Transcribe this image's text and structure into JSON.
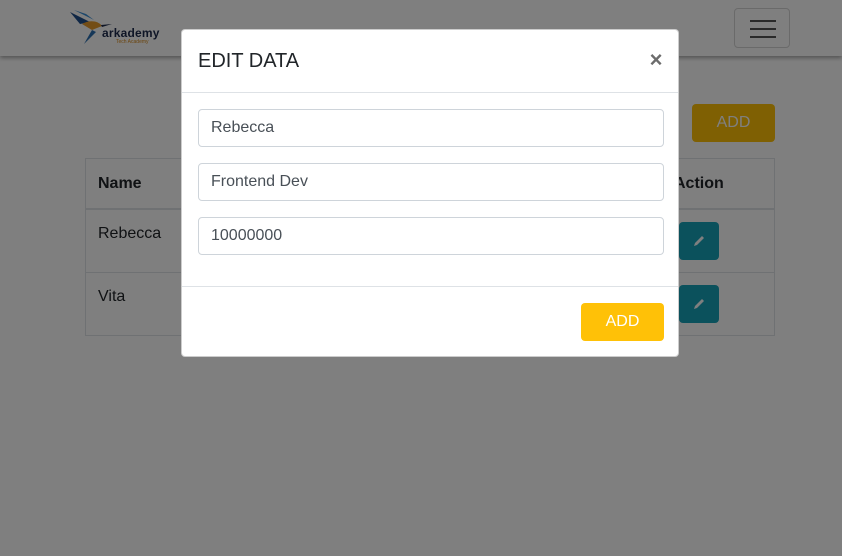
{
  "navbar": {
    "logo_text": "arkademy",
    "logo_subtext": "Tech Academy",
    "logo_icon": "hummingbird-logo",
    "menu_icon": "hamburger-menu-icon"
  },
  "main": {
    "add_label": "ADD",
    "table": {
      "headers": [
        "Name",
        "Action"
      ],
      "rows": [
        {
          "name": "Rebecca"
        },
        {
          "name": "Vita"
        }
      ],
      "edit_icon": "pencil-icon"
    }
  },
  "modal": {
    "title": "EDIT DATA",
    "close_label": "×",
    "fields": [
      {
        "value": "Rebecca"
      },
      {
        "value": "Frontend Dev"
      },
      {
        "value": "10000000"
      }
    ],
    "submit_label": "ADD"
  },
  "colors": {
    "accent": "#ffc107",
    "edit": "#17a2b8",
    "backdrop": "rgba(0,0,0,0.5)"
  }
}
